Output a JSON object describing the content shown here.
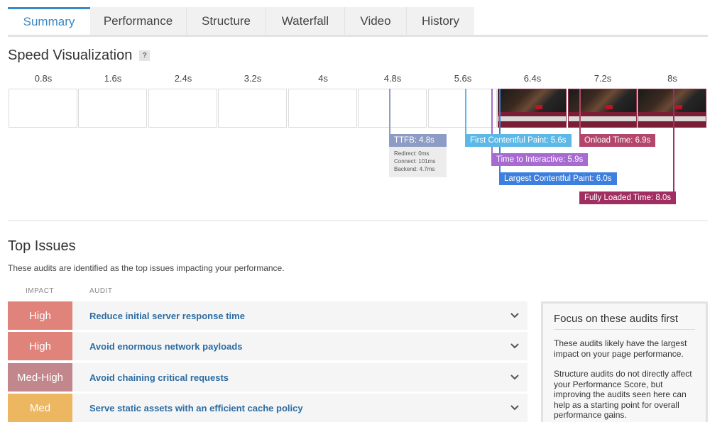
{
  "tabs": [
    "Summary",
    "Performance",
    "Structure",
    "Waterfall",
    "Video",
    "History"
  ],
  "speed_visualization": {
    "title": "Speed Visualization",
    "help_label": "?",
    "ticks": [
      "0.8s",
      "1.6s",
      "2.4s",
      "3.2s",
      "4s",
      "4.8s",
      "5.6s",
      "6.4s",
      "7.2s",
      "8s"
    ],
    "markers": {
      "ttfb": "TTFB: 4.8s",
      "fcp": "First Contentful Paint: 5.6s",
      "onload": "Onload Time: 6.9s",
      "tti": "Time to Interactive: 5.9s",
      "lcp": "Largest Contentful Paint: 6.0s",
      "fully_loaded": "Fully Loaded Time: 8.0s"
    },
    "ttfb_details": [
      "Redirect: 0ms",
      "Connect: 101ms",
      "Backend: 4.7ms"
    ],
    "colors": {
      "ttfb": "#8c9cc4",
      "fcp": "#5cb8e6",
      "onload": "#b3476b",
      "tti": "#a66ad0",
      "lcp": "#3d7fde",
      "fully_loaded": "#a02e60"
    }
  },
  "top_issues": {
    "title": "Top Issues",
    "description": "These audits are identified as the top issues impacting your performance.",
    "columns": {
      "impact": "IMPACT",
      "audit": "AUDIT"
    },
    "rows": [
      {
        "impact": "High",
        "audit": "Reduce initial server response time",
        "color": "#e0837a"
      },
      {
        "impact": "High",
        "audit": "Avoid enormous network payloads",
        "color": "#e0837a"
      },
      {
        "impact": "Med-High",
        "audit": "Avoid chaining critical requests",
        "color": "#c2878c"
      },
      {
        "impact": "Med",
        "audit": "Serve static assets with an efficient cache policy",
        "color": "#edb761"
      }
    ]
  },
  "focus_panel": {
    "title": "Focus on these audits first",
    "paragraph_1": "These audits likely have the largest impact on your page performance.",
    "paragraph_2": "Structure audits do not directly affect your Performance Score, but improving the audits seen here can help as a starting point for overall performance gains."
  }
}
